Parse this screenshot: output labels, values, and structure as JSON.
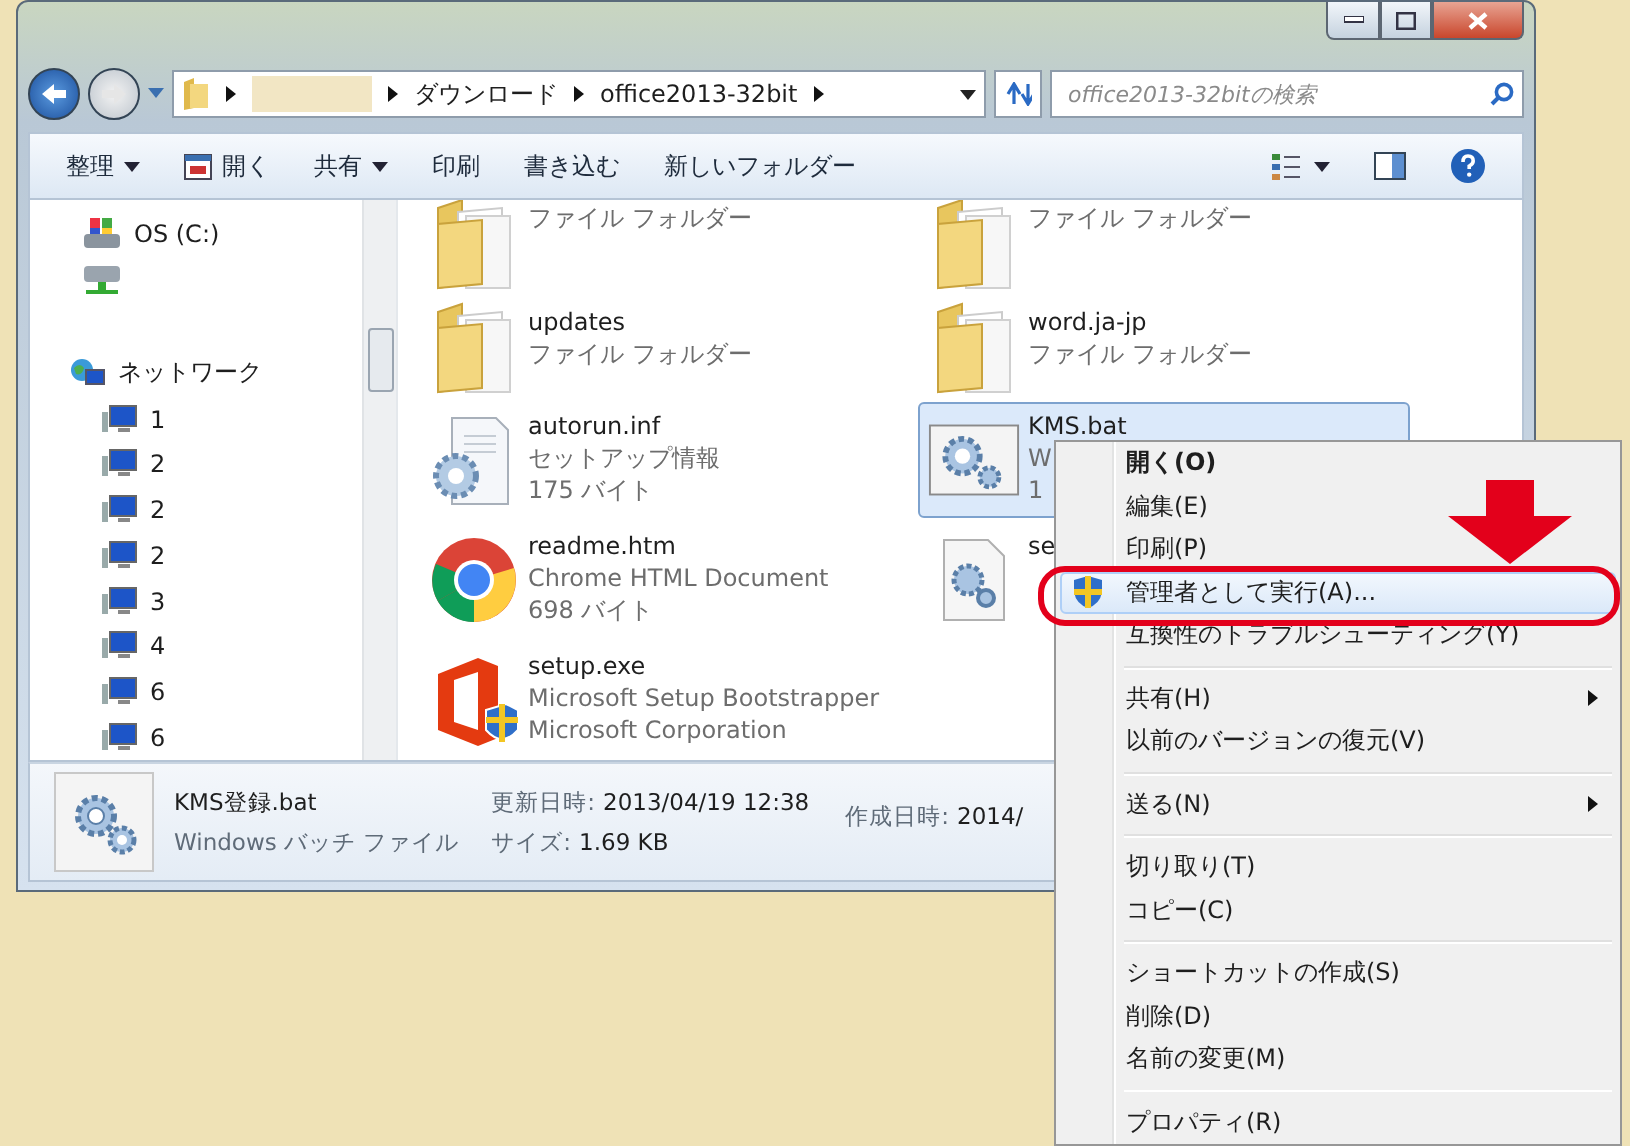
{
  "address": {
    "crumbs": [
      {
        "kind": "redacted"
      },
      {
        "kind": "text",
        "label": "ダウンロード"
      },
      {
        "kind": "text",
        "label": "office2013-32bit"
      }
    ]
  },
  "search": {
    "placeholder": "office2013-32bitの検索"
  },
  "toolbar": [
    {
      "label": "整理",
      "kind": "menu"
    },
    {
      "label": "開く",
      "kind": "icon"
    },
    {
      "label": "共有",
      "kind": "menu"
    },
    {
      "label": "印刷",
      "kind": "plain"
    },
    {
      "label": "書き込む",
      "kind": "plain"
    },
    {
      "label": "新しいフォルダー",
      "kind": "plain"
    }
  ],
  "sidebar": {
    "items": [
      {
        "label": "OS (C:)",
        "kind": "drive"
      },
      {
        "kind": "netdrive"
      }
    ],
    "network": {
      "label": "ネットワーク",
      "children": [
        {
          "label": "1"
        },
        {
          "label": "2"
        },
        {
          "label": "2"
        },
        {
          "label": "2"
        },
        {
          "label": "3"
        },
        {
          "label": "4"
        },
        {
          "label": "6"
        },
        {
          "label": "6"
        }
      ]
    }
  },
  "files": [
    {
      "kind": "folder",
      "lines": [
        "ファイル フォルダー"
      ],
      "selected": false
    },
    {
      "kind": "folder",
      "lines": [
        "ファイル フォルダー"
      ],
      "selected": false
    },
    {
      "kind": "folder",
      "name": "updates",
      "lines": [
        "ファイル フォルダー"
      ],
      "selected": false
    },
    {
      "kind": "folder",
      "name": "word.ja-jp",
      "lines": [
        "ファイル フォルダー"
      ],
      "selected": false
    },
    {
      "kind": "setup",
      "name": "autorun.inf",
      "lines": [
        "セットアップ情報",
        "175 バイト"
      ],
      "selected": false
    },
    {
      "kind": "batch",
      "name": "KMS.bat",
      "lines": [
        "W",
        "1"
      ],
      "selected": true
    },
    {
      "kind": "chrome",
      "name": "readme.htm",
      "lines": [
        "Chrome HTML Document",
        "698 バイト"
      ],
      "selected": false
    },
    {
      "kind": "config",
      "name": "se",
      "selected": false
    },
    {
      "kind": "office",
      "name": "setup.exe",
      "lines": [
        "Microsoft Setup Bootstrapper",
        "Microsoft Corporation"
      ],
      "selected": false
    }
  ],
  "details": {
    "name": "KMS登録.bat",
    "type": "Windows バッチ ファイル",
    "fields": [
      {
        "label": "更新日時:",
        "value": "2013/04/19 12:38"
      },
      {
        "label": "作成日時:",
        "value": "2014/"
      },
      {
        "label": "サイズ:",
        "value": "1.69 KB"
      }
    ]
  },
  "context_menu": {
    "groups": [
      [
        {
          "label": "開く(O)",
          "kind": "plain",
          "default": true,
          "highlighted": false,
          "submenu": false
        },
        {
          "label": "編集(E)",
          "kind": "plain",
          "default": false,
          "highlighted": false,
          "submenu": false
        },
        {
          "label": "印刷(P)",
          "kind": "plain",
          "default": false,
          "highlighted": false,
          "submenu": false
        },
        {
          "label": "管理者として実行(A)...",
          "kind": "shield",
          "default": false,
          "highlighted": true,
          "submenu": false
        },
        {
          "label": "互換性のトラブルシューティング(Y)",
          "kind": "plain",
          "default": false,
          "highlighted": false,
          "submenu": false
        }
      ],
      [
        {
          "label": "共有(H)",
          "kind": "plain",
          "default": false,
          "highlighted": false,
          "submenu": true
        },
        {
          "label": "以前のバージョンの復元(V)",
          "kind": "plain",
          "default": false,
          "highlighted": false,
          "submenu": false
        }
      ],
      [
        {
          "label": "送る(N)",
          "kind": "plain",
          "default": false,
          "highlighted": false,
          "submenu": true
        }
      ],
      [
        {
          "label": "切り取り(T)",
          "kind": "plain",
          "default": false,
          "highlighted": false,
          "submenu": false
        },
        {
          "label": "コピー(C)",
          "kind": "plain",
          "default": false,
          "highlighted": false,
          "submenu": false
        }
      ],
      [
        {
          "label": "ショートカットの作成(S)",
          "kind": "plain",
          "default": false,
          "highlighted": false,
          "submenu": false
        },
        {
          "label": "削除(D)",
          "kind": "plain",
          "default": false,
          "highlighted": false,
          "submenu": false
        },
        {
          "label": "名前の変更(M)",
          "kind": "plain",
          "default": false,
          "highlighted": false,
          "submenu": false
        }
      ],
      [
        {
          "label": "プロパティ(R)",
          "kind": "plain",
          "default": false,
          "highlighted": false,
          "submenu": false
        }
      ]
    ]
  }
}
